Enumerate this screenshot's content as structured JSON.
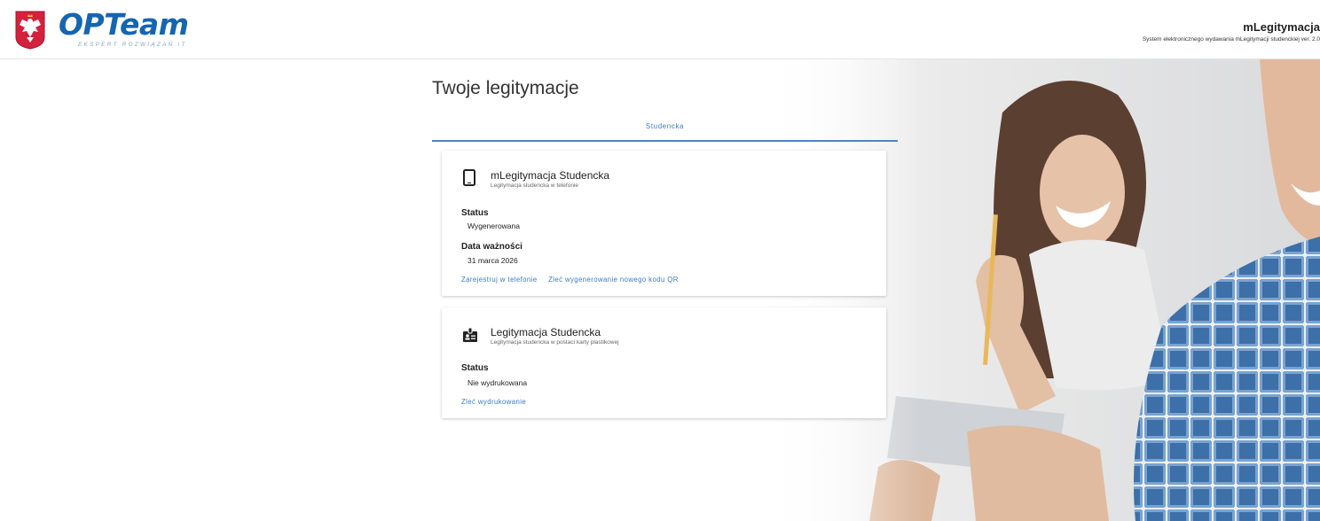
{
  "header": {
    "logo_text": "OPTeam",
    "logo_subtitle": "EKSPERT ROZWIĄZAŃ IT",
    "app_title": "mLegitymacja",
    "app_subtitle": "System elektronicznego wydawania mLegitymacji studenckiej ver. 2.0"
  },
  "page": {
    "title": "Twoje legitymacje"
  },
  "tabs": [
    {
      "label": "Studencka",
      "active": true
    }
  ],
  "cards": [
    {
      "icon": "phone-icon",
      "title": "mLegitymacja Studencka",
      "subtitle": "Legitymacja studencka w telefonie",
      "status_label": "Status",
      "status_value": "Wygenerowana",
      "expiry_label": "Data ważności",
      "expiry_value": "31 marca 2026",
      "actions": [
        "Zarejestruj w telefonie",
        "Zleć wygenerowanie nowego kodu QR"
      ]
    },
    {
      "icon": "id-badge-icon",
      "title": "Legitymacja Studencka",
      "subtitle": "Legitymacja studencka w postaci karty plastikowej",
      "status_label": "Status",
      "status_value": "Nie wydrukowana",
      "actions": [
        "Zleć wydrukowanie"
      ]
    }
  ],
  "colors": {
    "accent": "#3a7bc4",
    "brand": "#1565b0",
    "emblem_red": "#d4213d"
  }
}
